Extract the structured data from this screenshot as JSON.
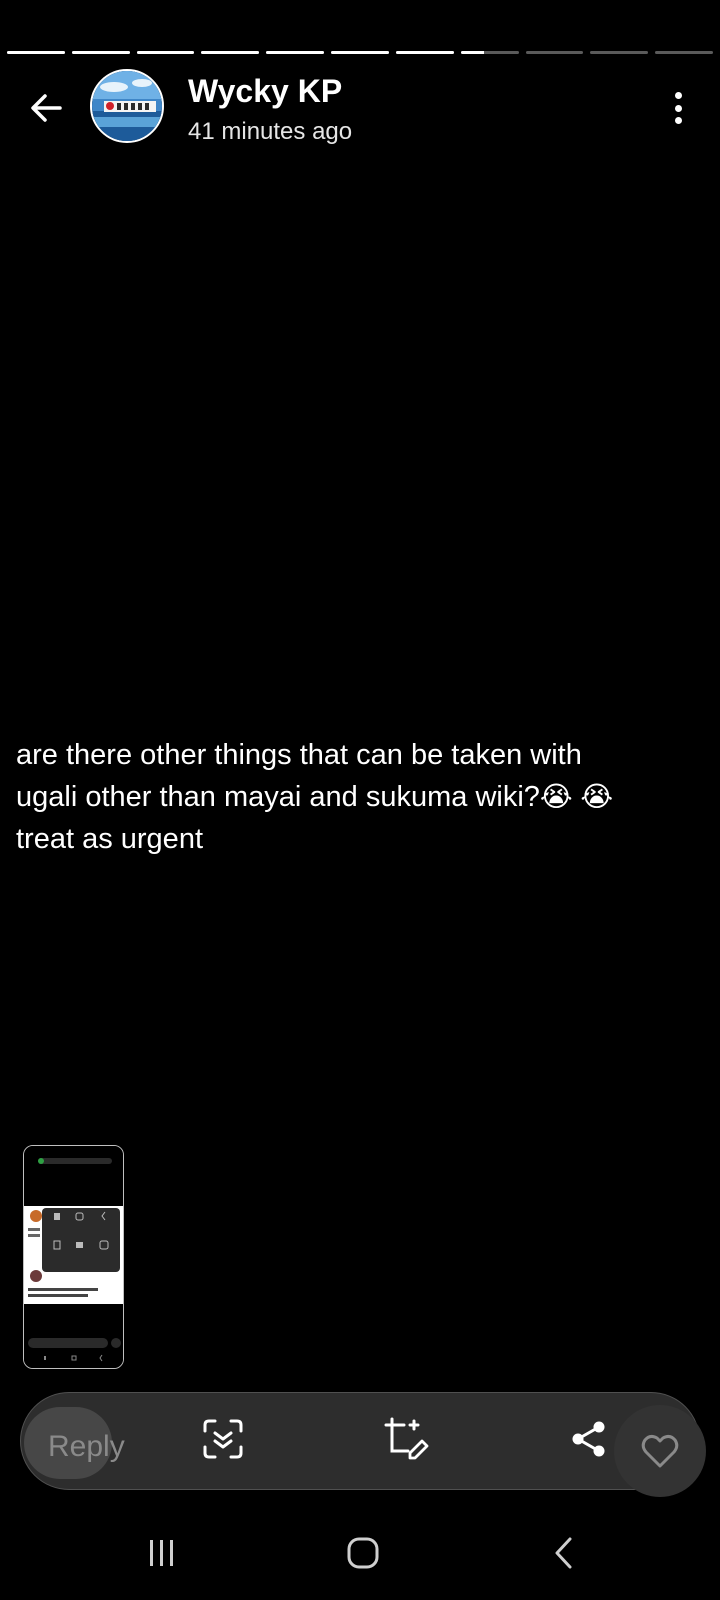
{
  "story": {
    "segments_total": 11,
    "segments_complete": 7,
    "current_segment_progress": 0.4,
    "user_name": "Wycky KP",
    "posted_time": "41 minutes ago",
    "post_text_line1": "are there other things that can be taken with",
    "post_text_line2": "ugali other than mayai and sukuma wiki?",
    "post_emoji": "😭 😭",
    "post_text_line3": "treat as urgent"
  },
  "actions": {
    "reply_placeholder": "Reply"
  },
  "icons": {
    "back": "arrow-left-icon",
    "more": "more-vertical-icon",
    "scan": "scan-icon",
    "edit": "crop-edit-icon",
    "share": "share-icon",
    "like": "heart-icon",
    "nav_recents": "recents-icon",
    "nav_home": "home-icon",
    "nav_back": "chevron-left-icon"
  },
  "colors": {
    "background": "#000000",
    "progress_active": "#ffffff",
    "progress_inactive": "#5a5a5a",
    "action_bar": "#2d2d2d"
  }
}
